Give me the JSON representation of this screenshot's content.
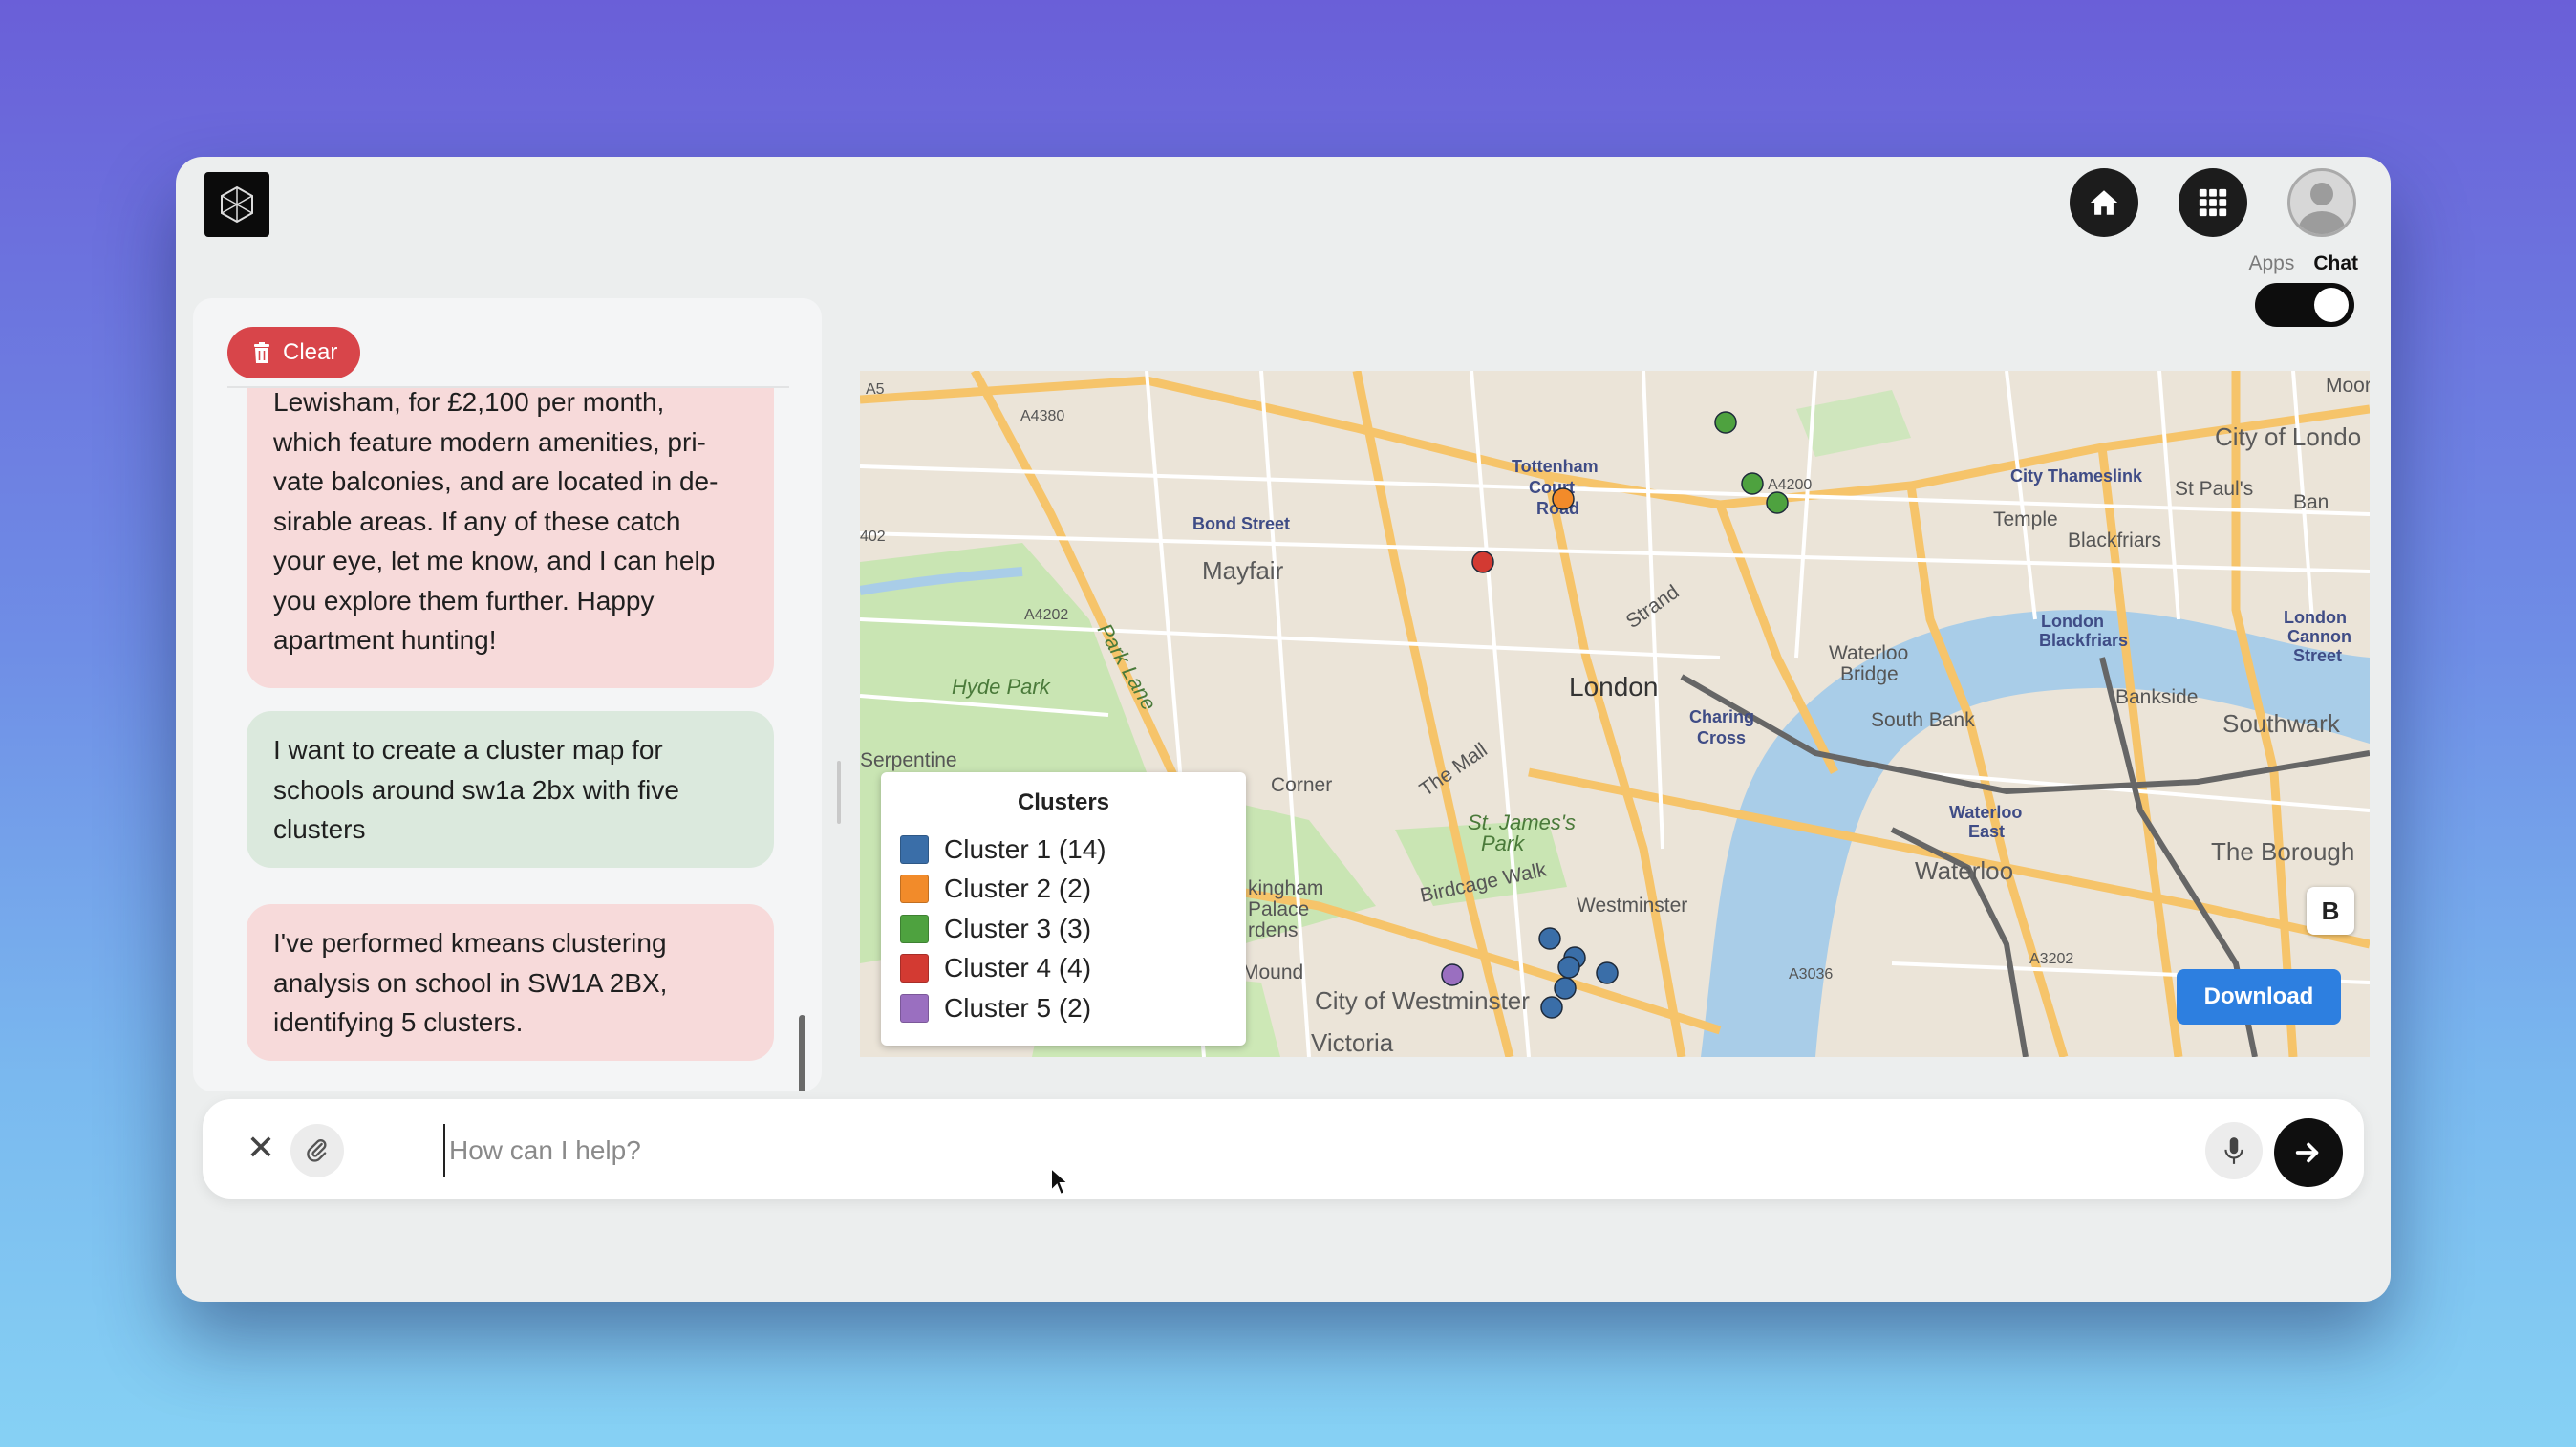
{
  "header": {
    "logo_icon": "cube-logo-icon",
    "home_icon": "home-icon",
    "apps_icon": "grid-icon",
    "avatar_icon": "user-avatar-icon",
    "toggle": {
      "left_label": "Apps",
      "right_label": "Chat",
      "state": "Chat"
    }
  },
  "chat": {
    "clear_label": "Clear",
    "messages": [
      {
        "role": "assistant",
        "lines": [
          "Lewisham, for £2,100 per month,",
          "which feature modern amenities, pri-",
          "vate balconies, and are located in de-",
          "sirable areas. If any of these catch",
          "your eye, let me know, and I can help",
          "you explore them further. Happy",
          "apartment hunting!"
        ]
      },
      {
        "role": "user",
        "lines": [
          "I want to create a cluster map for",
          "schools around sw1a 2bx with five",
          "clusters"
        ]
      },
      {
        "role": "assistant",
        "lines": [
          "I've performed kmeans clustering",
          "analysis on school in SW1A 2BX,",
          "identifying 5 clusters."
        ]
      }
    ]
  },
  "map": {
    "place_labels": {
      "a5": "A5",
      "a4380": "A4380",
      "a402": "402",
      "a4202": "A4202",
      "a4200": "A4200",
      "a3036": "A3036",
      "a3202": "A3202",
      "bond_street": "Bond Street",
      "mayfair": "Mayfair",
      "hyde_park": "Hyde Park",
      "park_lane": "Park Lane",
      "tottenham": "Tottenham",
      "court": "Court",
      "road": "Road",
      "london": "London",
      "strand": "Strand",
      "charing": "Charing",
      "cross": "Cross",
      "waterloo_bridge_1": "Waterloo",
      "waterloo_bridge_2": "Bridge",
      "south_bank": "South Bank",
      "city_of_london": "City of Londo",
      "city_thameslink": "City Thameslink",
      "st_pauls": "St Paul's",
      "temple": "Temple",
      "blackfriars": "Blackfriars",
      "london_blackfriars_1": "London",
      "london_blackfriars_2": "Blackfriars",
      "bankside": "Bankside",
      "london_cannon_1": "London",
      "london_cannon_2": "Cannon",
      "london_cannon_3": "Street",
      "southwark": "Southwark",
      "waterloo_east_1": "Waterloo",
      "waterloo_east_2": "East",
      "waterloo": "Waterloo",
      "the_borough": "The Borough",
      "westminster": "Westminster",
      "city_of_westminster": "City of Westminster",
      "victoria": "Victoria",
      "st_james_1": "St. James's",
      "st_james_2": "Park",
      "the_mall": "The Mall",
      "birdcage_walk": "Birdcage Walk",
      "corner": "Corner",
      "serpentine": "Serpentine",
      "ban": "Ban",
      "moorg": "Moorg",
      "mound": "Mound",
      "kingham": "kingham",
      "palace": "Palace",
      "rdens": "rdens"
    },
    "legend": {
      "title": "Clusters",
      "items": [
        {
          "label": "Cluster 1 (14)",
          "color": "#3a6ea8"
        },
        {
          "label": "Cluster 2 (2)",
          "color": "#f28b2a"
        },
        {
          "label": "Cluster 3 (3)",
          "color": "#4ea23f"
        },
        {
          "label": "Cluster 4 (4)",
          "color": "#d33a32"
        },
        {
          "label": "Cluster 5 (2)",
          "color": "#9a6fc0"
        }
      ]
    },
    "basemap_button": "B",
    "download_label": "Download"
  },
  "input": {
    "placeholder": "How can I help?",
    "value": "",
    "close_icon": "close-icon",
    "attach_icon": "paperclip-icon",
    "mic_icon": "microphone-icon",
    "send_icon": "arrow-right-icon"
  }
}
